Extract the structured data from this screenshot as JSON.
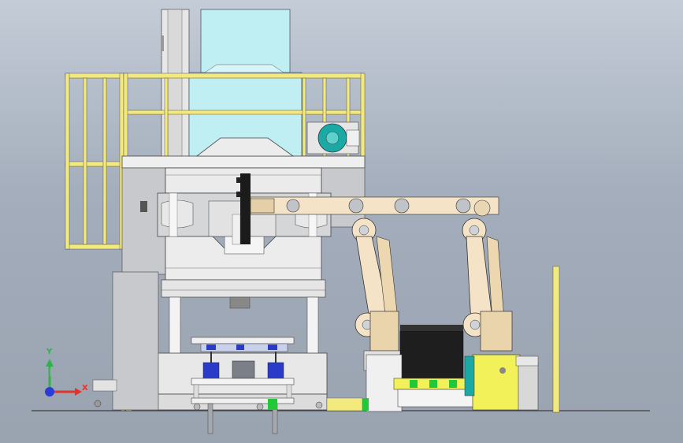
{
  "view": {
    "axes": {
      "x_label": "X",
      "y_label": "Y",
      "x_color": "#e0342c",
      "y_color": "#2fb34a",
      "z_color": "#2c3bd6"
    }
  },
  "palette": {
    "background_top": "#c3ccd7",
    "background_bottom": "#9aa3b0",
    "press_frame": "#e7e7e7",
    "press_dark": "#b9bcc0",
    "hydraulic_unit": "#bfeff2",
    "guard_rail": "#f3ea7e",
    "robot_arm": "#f4e3c6",
    "yellow_unit": "#f2f15a",
    "green_blocks": "#1fc93a",
    "motor_teal": "#1aa9a4",
    "floor_line": "#3c3c3c"
  },
  "components": {
    "press": "hydraulic-press",
    "robots": [
      "robot-arm-left",
      "robot-arm-right"
    ],
    "guard": "safety-railing",
    "cart": "die-cart"
  }
}
